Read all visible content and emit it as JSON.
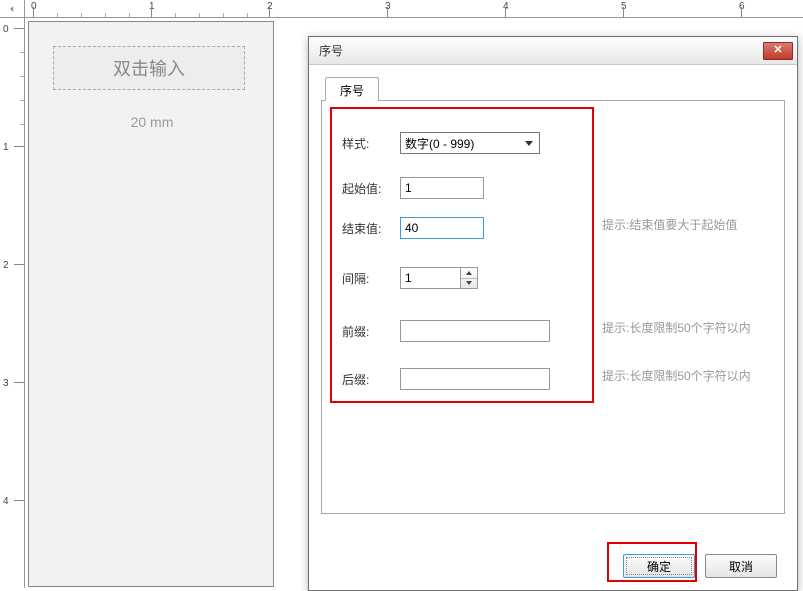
{
  "ruler_h": [
    "0",
    "1",
    "2",
    "3",
    "4",
    "5",
    "6"
  ],
  "ruler_v": [
    "0",
    "1",
    "2",
    "3",
    "4"
  ],
  "canvas": {
    "placeholder_text": "双击输入",
    "size_label": "20 mm"
  },
  "dialog": {
    "title": "序号",
    "tab_label": "序号",
    "fields": {
      "style_label": "样式:",
      "style_value": "数字(0 - 999)",
      "start_label": "起始值:",
      "start_value": "1",
      "end_label": "结束值:",
      "end_value": "40",
      "end_hint": "提示:结束值要大于起始值",
      "interval_label": "间隔:",
      "interval_value": "1",
      "prefix_label": "前缀:",
      "prefix_value": "",
      "prefix_hint": "提示:长度限制50个字符以内",
      "suffix_label": "后缀:",
      "suffix_value": "",
      "suffix_hint": "提示:长度限制50个字符以内"
    },
    "buttons": {
      "ok": "确定",
      "cancel": "取消"
    }
  }
}
